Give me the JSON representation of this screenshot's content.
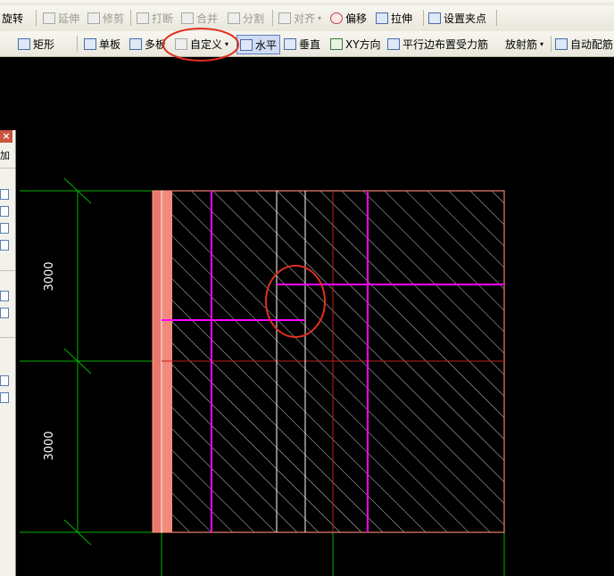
{
  "toolbar_row1": {
    "rotate_label": "旋转",
    "extend_label": "延伸",
    "trim_label": "修剪",
    "break_label": "打断",
    "merge_label": "合并",
    "split_label": "分割",
    "align_label": "对齐",
    "offset_label": "偏移",
    "stretch_label": "拉伸",
    "set_grip_label": "设置夹点"
  },
  "toolbar_row2": {
    "rect_label": "矩形",
    "single_slab_label": "单板",
    "multi_slab_label": "多板",
    "custom_label": "自定义",
    "horizontal_label": "水平",
    "vertical_label": "垂直",
    "xy_label": "XY方向",
    "parallel_edge_label": "平行边布置受力筋",
    "radial_label": "放射筋",
    "auto_rebar_label": "自动配筋"
  },
  "dock": {
    "header_label": "加"
  },
  "drawing": {
    "dim_top": "3000",
    "dim_bottom": "3000"
  },
  "colors": {
    "background": "#000000",
    "slab_edge": "#f08070",
    "rebar": "#ff00ff",
    "axis_grid": "#00cc00",
    "hatch": "#ffffff",
    "annotation": "#e03020"
  },
  "icons": {
    "custom_icon": "custom-shape-icon",
    "horizontal_icon": "horizontal-rebar-icon"
  }
}
